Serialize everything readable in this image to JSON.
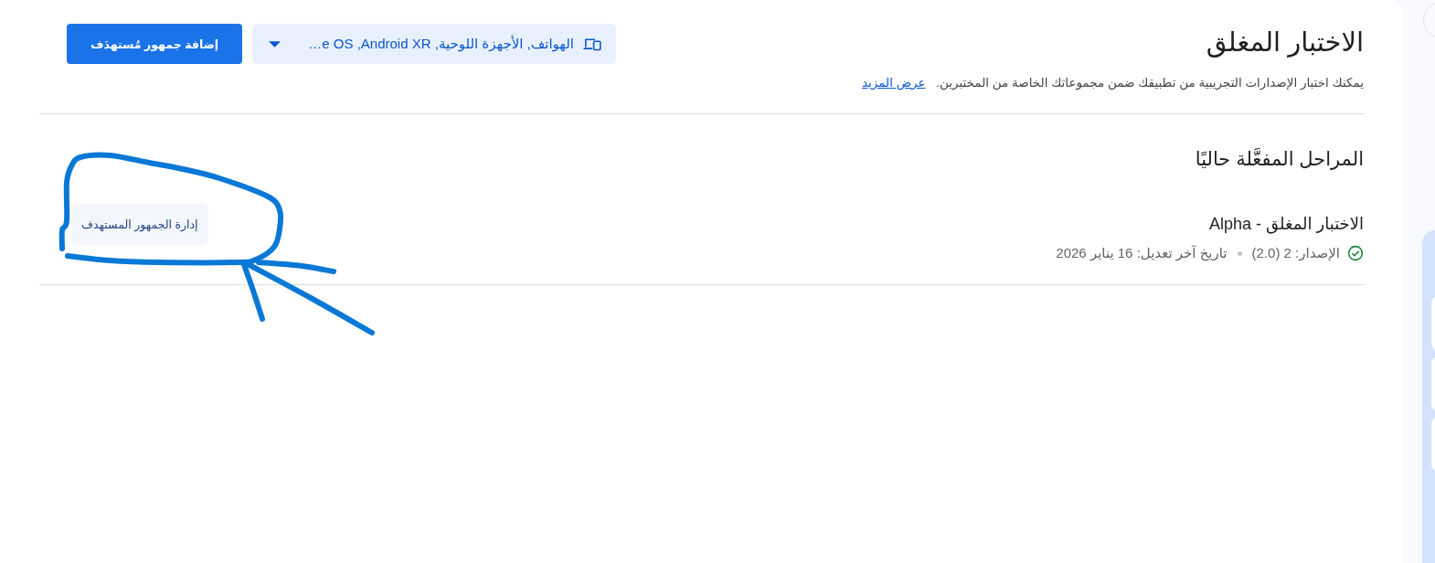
{
  "header": {
    "title": "الاختبار المغلق",
    "description": "يمكنك اختبار الإصدارات التجريبية من تطبيقك ضمن مجموعاتك الخاصة من المختبرين.",
    "learn_more_link": "عرض المزيد",
    "device_filter": {
      "value": "الهواتف, الأجهزة اللوحية, Android XR, e OS…"
    },
    "add_audience_button": "إضافة جمهور مُستهدَف"
  },
  "active_tracks": {
    "heading": "المراحل المفعَّلة حاليًا",
    "tracks": [
      {
        "name": "الاختبار المغلق - Alpha",
        "released": true,
        "release": "الإصدار: 2 (2.0)",
        "last_updated": "تاريخ آخر تعديل: 16 يناير 2026",
        "manage_button": "إدارة الجمهور المستهدف"
      }
    ]
  }
}
